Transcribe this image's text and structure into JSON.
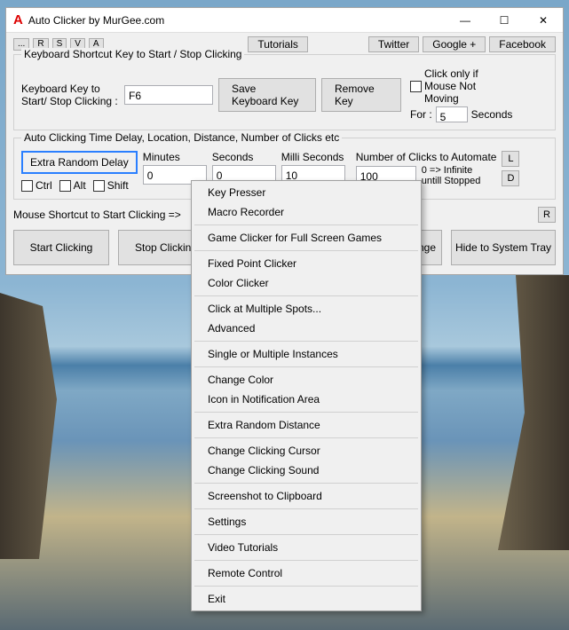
{
  "window": {
    "title": "Auto Clicker by MurGee.com",
    "minimize": "—",
    "maximize": "☐",
    "close": "✕"
  },
  "toolbar_small": [
    "...",
    "R",
    "S",
    "V",
    "A"
  ],
  "links": {
    "tutorials": "Tutorials",
    "twitter": "Twitter",
    "google": "Google +",
    "facebook": "Facebook"
  },
  "shortcut_group": {
    "title": "Keyboard Shortcut Key to Start / Stop Clicking",
    "label": "Keyboard Key to\nStart/ Stop Clicking :",
    "value": "F6",
    "save": "Save Keyboard Key",
    "remove": "Remove Key",
    "click_only_if": "Click only if Mouse Not Moving",
    "for": "For :",
    "for_value": "5",
    "seconds": "Seconds"
  },
  "delay_group": {
    "title": "Auto Clicking Time Delay, Location, Distance, Number of Clicks etc",
    "extra": "Extra Random Delay",
    "ctrl": "Ctrl",
    "alt": "Alt",
    "shift": "Shift",
    "minutes_l": "Minutes",
    "seconds_l": "Seconds",
    "ms_l": "Milli Seconds",
    "minutes": "0",
    "seconds": "0",
    "ms": "10",
    "num_l": "Number of Clicks to Automate",
    "num": "100",
    "infinite": "0 => Infinite untill Stopped",
    "L": "L",
    "D": "D"
  },
  "mouse_shortcut": "Mouse Shortcut to Start Clicking =>",
  "R": "R",
  "buttons": {
    "start": "Start Clicking",
    "stop": "Stop Clicking",
    "change_partial": "ange",
    "hide": "Hide to System Tray"
  },
  "menu": [
    "Key Presser",
    "Macro Recorder",
    "-",
    "Game Clicker for Full Screen Games",
    "-",
    "Fixed Point Clicker",
    "Color Clicker",
    "-",
    "Click at Multiple Spots...",
    "Advanced",
    "-",
    "Single or Multiple Instances",
    "-",
    "Change Color",
    "Icon in Notification Area",
    "-",
    "Extra Random Distance",
    "-",
    "Change Clicking Cursor",
    "Change Clicking Sound",
    "-",
    "Screenshot to Clipboard",
    "-",
    "Settings",
    "-",
    "Video Tutorials",
    "-",
    "Remote Control",
    "-",
    "Exit"
  ]
}
